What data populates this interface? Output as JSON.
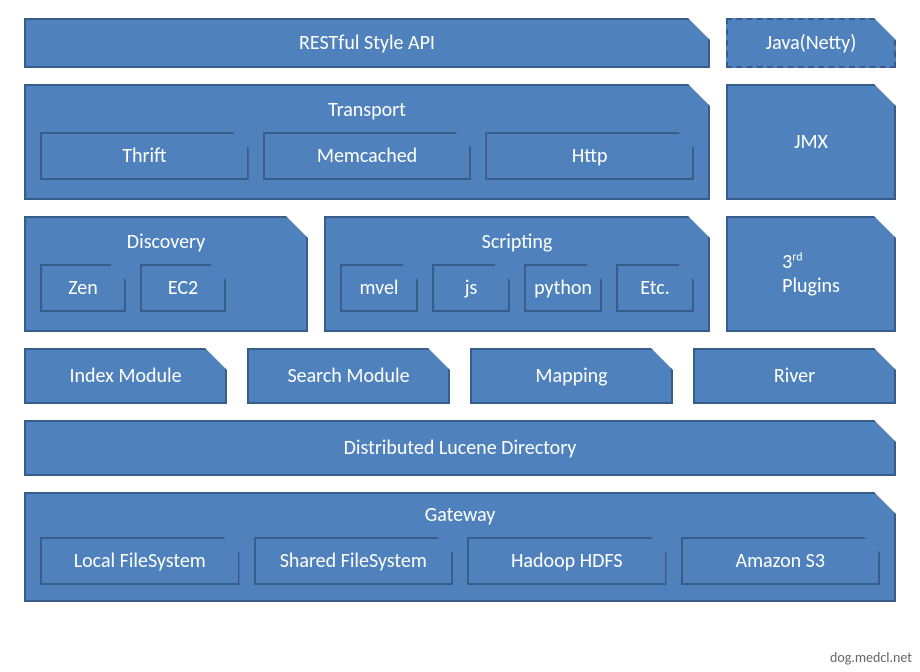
{
  "row1": {
    "api": "RESTful Style API",
    "netty": "Java(Netty)"
  },
  "row2": {
    "transport": {
      "title": "Transport",
      "items": [
        "Thrift",
        "Memcached",
        "Http"
      ]
    },
    "jmx": "JMX"
  },
  "row3": {
    "discovery": {
      "title": "Discovery",
      "items": [
        "Zen",
        "EC2"
      ]
    },
    "scripting": {
      "title": "Scripting",
      "items": [
        "mvel",
        "js",
        "python",
        "Etc."
      ]
    },
    "plugins_pre": "3",
    "plugins_sup": "rd",
    "plugins_post": "Plugins"
  },
  "row4": {
    "items": [
      "Index Module",
      "Search Module",
      "Mapping",
      "River"
    ]
  },
  "row5": {
    "title": "Distributed Lucene Directory"
  },
  "row6": {
    "gateway": {
      "title": "Gateway",
      "items": [
        "Local FileSystem",
        "Shared FileSystem",
        "Hadoop HDFS",
        "Amazon S3"
      ]
    }
  },
  "watermark": "dog.medcl.net"
}
